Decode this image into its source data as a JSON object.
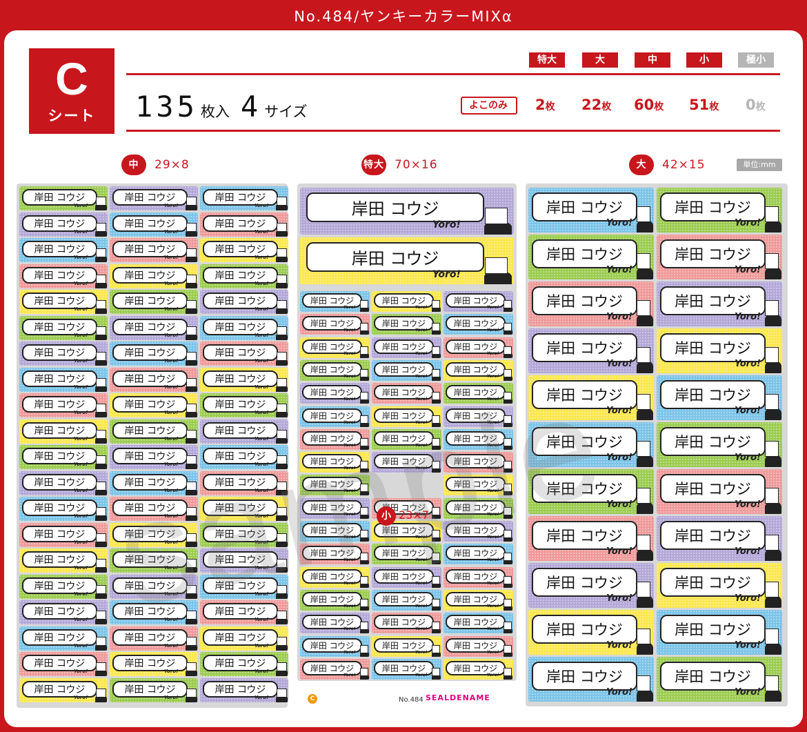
{
  "header": {
    "title": "No.484/ヤンキーカラーMIXα"
  },
  "sheet": {
    "letter": "C",
    "word": "シート"
  },
  "summary": {
    "count": "135",
    "count_unit": "枚入",
    "sizes": "4",
    "sizes_unit": "サイズ"
  },
  "size_tags": [
    "特大",
    "大",
    "中",
    "小",
    "極小"
  ],
  "orientation": "よこのみ",
  "counts": [
    {
      "value": "2",
      "unit": "枚"
    },
    {
      "value": "22",
      "unit": "枚"
    },
    {
      "value": "60",
      "unit": "枚"
    },
    {
      "value": "51",
      "unit": "枚"
    },
    {
      "value": "0",
      "unit": "枚"
    }
  ],
  "sections": {
    "medium": {
      "tag": "中",
      "dims": "29×8"
    },
    "xlarge": {
      "tag": "特大",
      "dims": "70×16"
    },
    "large": {
      "tag": "大",
      "dims": "42×15"
    },
    "small": {
      "tag": "小",
      "dims": "23×7"
    }
  },
  "unit_note": "単位:mm",
  "label": {
    "name": "岸田 コウジ",
    "tagline": "Yoro!"
  },
  "watermark": "sample",
  "colors": {
    "green": "#9ccc50",
    "pink": "#ef9a9a",
    "purple": "#b3a8d8",
    "yellow": "#fbe74e",
    "blue": "#7cc4e8",
    "accent": "#c8161d"
  },
  "label_colors": {
    "medium": [
      "green",
      "purple",
      "blue",
      "pink",
      "yellow",
      "green",
      "purple",
      "blue",
      "pink",
      "yellow",
      "green",
      "purple",
      "blue",
      "pink",
      "yellow",
      "green",
      "purple",
      "blue",
      "pink",
      "yellow"
    ],
    "xlarge": [
      "purple",
      "yellow"
    ],
    "small": [
      "blue",
      "pink",
      "yellow",
      "green",
      "purple",
      "blue",
      "pink",
      "yellow",
      "green",
      "purple",
      "blue",
      "pink",
      "yellow",
      "green",
      "purple",
      "blue",
      "pink",
      "yellow"
    ],
    "large": [
      "blue",
      "green",
      "green",
      "pink",
      "pink",
      "purple",
      "purple",
      "yellow",
      "yellow",
      "blue",
      "blue",
      "green",
      "green",
      "pink",
      "pink",
      "purple",
      "purple",
      "yellow",
      "yellow",
      "blue",
      "blue",
      "green"
    ]
  },
  "footer": {
    "sheet_mark": "C",
    "number": "No.484",
    "brand": "SEALDENAME"
  }
}
